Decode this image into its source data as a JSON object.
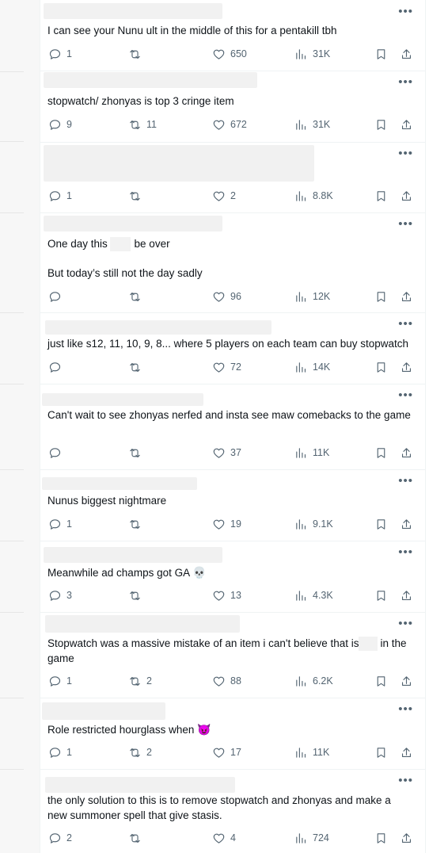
{
  "tweets": [
    {
      "text": "I can see your Nunu ult in the middle of this for a pentakill tbh",
      "replies": "1",
      "reposts": "",
      "likes": "650",
      "views": "31K"
    },
    {
      "text": "stopwatch/ zhonyas is top 3 cringe item",
      "replies": "9",
      "reposts": "11",
      "likes": "672",
      "views": "31K"
    },
    {
      "text": "",
      "replies": "1",
      "reposts": "",
      "likes": "2",
      "views": "8.8K"
    },
    {
      "text": "One day this        : will be over\n\nBut today’s still not the day sadly",
      "replies": "",
      "reposts": "",
      "likes": "96",
      "views": "12K"
    },
    {
      "text": "just like s12, 11, 10, 9, 8... where 5 players on each team can buy stopwatch",
      "replies": "",
      "reposts": "",
      "likes": "72",
      "views": "14K"
    },
    {
      "text": "Can't wait to see zhonyas nerfed and insta see maw comebacks to the game",
      "replies": "",
      "reposts": "",
      "likes": "37",
      "views": "11K"
    },
    {
      "text": "Nunus biggest nightmare",
      "replies": "1",
      "reposts": "",
      "likes": "19",
      "views": "9.1K"
    },
    {
      "text": "Meanwhile ad champs got GA",
      "emoji": "💀",
      "replies": "3",
      "reposts": "",
      "likes": "13",
      "views": "4.3K"
    },
    {
      "text": "Stopwatch was a massive mistake of an item i can't believe that          is still in the game",
      "replies": "1",
      "reposts": "2",
      "likes": "88",
      "views": "6.2K"
    },
    {
      "text": "Role restricted hourglass when",
      "emoji": "😈",
      "replies": "1",
      "reposts": "2",
      "likes": "17",
      "views": "11K"
    },
    {
      "text": "the only solution to this is to remove stopwatch and zhonyas and make a new summoner spell that give stasis.",
      "replies": "2",
      "reposts": "",
      "likes": "4",
      "views": "724"
    }
  ],
  "icons": {
    "more": "more-horizontal-icon",
    "reply": "reply-icon",
    "repost": "repost-icon",
    "like": "heart-icon",
    "views": "views-chart-icon",
    "bookmark": "bookmark-icon",
    "share": "share-icon"
  },
  "colors": {
    "text": "#0f1419",
    "secondary": "#536471",
    "divider": "#eff3f4"
  }
}
